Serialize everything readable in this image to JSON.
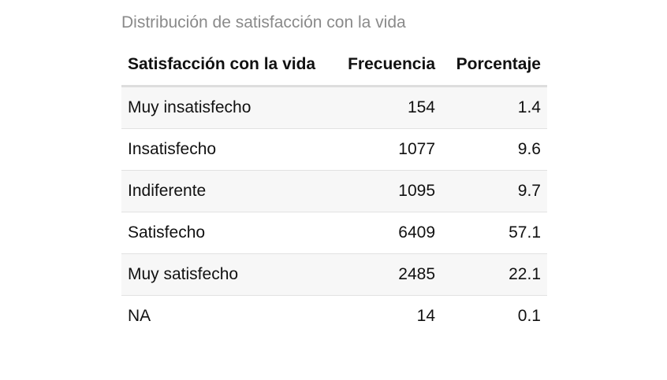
{
  "caption": "Distribución de satisfacción con la vida",
  "table": {
    "headers": [
      "Satisfacción con la vida",
      "Frecuencia",
      "Porcentaje"
    ],
    "rows": [
      [
        "Muy insatisfecho",
        "154",
        "1.4"
      ],
      [
        "Insatisfecho",
        "1077",
        "9.6"
      ],
      [
        "Indiferente",
        "1095",
        "9.7"
      ],
      [
        "Satisfecho",
        "6409",
        "57.1"
      ],
      [
        "Muy satisfecho",
        "2485",
        "22.1"
      ],
      [
        "NA",
        "14",
        "0.1"
      ]
    ]
  },
  "colors": {
    "caption": "#8a8a8a",
    "striped_row": "#f7f7f7",
    "header_rule": "#dddddd",
    "row_rule": "#e2e2e2"
  }
}
